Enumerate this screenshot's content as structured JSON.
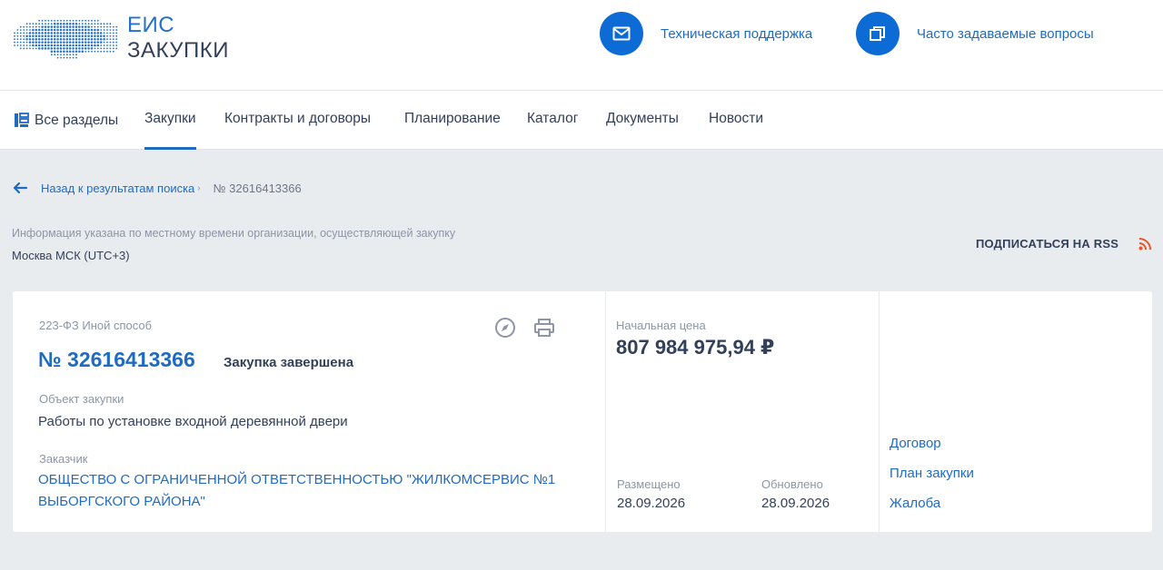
{
  "header": {
    "logo_line1": "ЕИС",
    "logo_line2": "ЗАКУПКИ",
    "support_label": "Техническая поддержка",
    "faq_label": "Часто задаваемые вопросы"
  },
  "nav": {
    "all_sections": "Все разделы",
    "items": [
      "Закупки",
      "Контракты и договоры",
      "Планирование",
      "Каталог",
      "Документы",
      "Новости"
    ],
    "active": "Закупки"
  },
  "breadcrumb": {
    "back_label": "Назад к результатам поиска",
    "current": "№ 32616413366"
  },
  "timezone": {
    "note": "Информация указана по местному времени организации, осуществляющей закупку",
    "value": "Москва МСК (UTC+3)"
  },
  "rss": {
    "label": "ПОДПИСАТЬСЯ НА RSS"
  },
  "purchase": {
    "law_method": "223-ФЗ Иной способ",
    "number": "№ 32616413366",
    "status": "Закупка завершена",
    "object_label": "Объект закупки",
    "object_value": "Работы по установке входной деревянной двери",
    "customer_label": "Заказчик",
    "customer_value": "ОБЩЕСТВО С ОГРАНИЧЕННОЙ ОТВЕТСТВЕННОСТЬЮ \"ЖИЛКОМСЕРВИС №1 ВЫБОРГСКОГО РАЙОНА\"",
    "price_label": "Начальная цена",
    "price_value": "807 984 975,94 ₽",
    "posted_label": "Размещено",
    "posted_value": "28.09.2026",
    "updated_label": "Обновлено",
    "updated_value": "28.09.2026"
  },
  "side_links": [
    "Договор",
    "План закупки",
    "Жалоба"
  ],
  "colors": {
    "brand_blue": "#0d6bd6",
    "link_blue": "#1f6bc2",
    "text_dark": "#334059",
    "muted": "#8c96a5",
    "rss_orange": "#e8562a",
    "page_bg": "#e9ecef"
  },
  "icons": [
    "mail-icon",
    "copy-icon",
    "sections-icon",
    "back-arrow-icon",
    "rss-icon",
    "compass-icon",
    "print-icon"
  ]
}
